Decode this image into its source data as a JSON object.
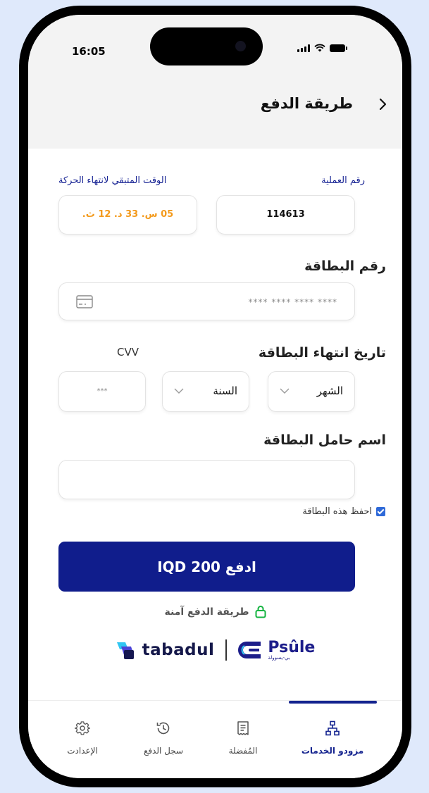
{
  "status_bar": {
    "time": "16:05"
  },
  "header": {
    "title": "طريقة الدفع"
  },
  "transaction": {
    "number_label": "رقم العملية",
    "number_value": "114613",
    "time_label": "الوقت المتبقي لانتهاء الحركة",
    "time_value": "05 س. 33 د. 12 ث."
  },
  "card_number": {
    "label": "رقم البطاقة",
    "placeholder": "**** **** **** ****"
  },
  "expiry": {
    "label": "تاريخ انتهاء البطاقة",
    "month": "الشهر",
    "year": "السنة"
  },
  "cvv": {
    "label": "CVV",
    "placeholder": "***"
  },
  "holder": {
    "label": "اسم حامل البطاقة",
    "value": ""
  },
  "save_card": {
    "label": "احفظ هذه البطاقة",
    "checked": true
  },
  "pay_button": {
    "label": "ادفع IQD 200"
  },
  "secure": {
    "label": "طريقة الدفع آمنة"
  },
  "logos": {
    "tabadul": "tabadul",
    "psule": "Psûle",
    "psule_sub": "بي-يسوولة"
  },
  "tabbar": {
    "items": [
      {
        "label": "مزودو الخدمات",
        "icon": "sitemap-icon",
        "active": true
      },
      {
        "label": "المُفضلة",
        "icon": "receipt-icon",
        "active": false
      },
      {
        "label": "سجل الدفع",
        "icon": "history-icon",
        "active": false
      },
      {
        "label": "الإعدادت",
        "icon": "gear-icon",
        "active": false
      }
    ]
  },
  "colors": {
    "accent": "#101d8c",
    "orange": "#f39a1c",
    "link_blue": "#182494"
  }
}
